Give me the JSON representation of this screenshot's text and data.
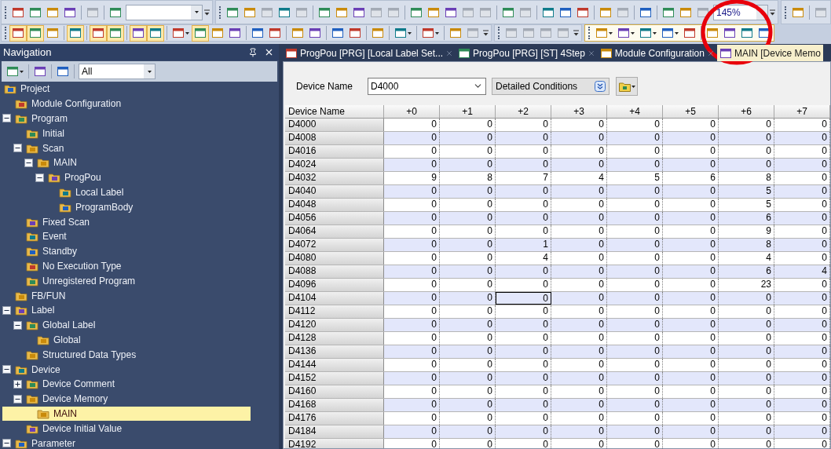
{
  "toolbars": [
    {
      "bands": [
        {
          "highlighted": false,
          "items": [
            {
              "kind": "grip"
            },
            {
              "kind": "button",
              "disabled": false,
              "on": false
            },
            {
              "kind": "button",
              "disabled": false,
              "on": false
            },
            {
              "kind": "button",
              "disabled": false,
              "on": false
            },
            {
              "kind": "button",
              "disabled": false,
              "on": false
            },
            {
              "kind": "separator"
            },
            {
              "kind": "button",
              "disabled": true,
              "on": false
            },
            {
              "kind": "separator"
            },
            {
              "kind": "button",
              "disabled": false,
              "on": false
            },
            {
              "kind": "combo"
            },
            {
              "kind": "overflow"
            }
          ]
        },
        {
          "highlighted": false,
          "items": [
            {
              "kind": "grip"
            },
            {
              "kind": "button",
              "disabled": false,
              "on": false
            },
            {
              "kind": "button",
              "disabled": false,
              "on": false
            },
            {
              "kind": "button",
              "disabled": true,
              "on": false
            },
            {
              "kind": "button",
              "disabled": false,
              "on": false
            },
            {
              "kind": "button",
              "disabled": true,
              "on": false
            },
            {
              "kind": "separator"
            },
            {
              "kind": "button",
              "disabled": false,
              "on": false
            },
            {
              "kind": "button",
              "disabled": false,
              "on": false
            },
            {
              "kind": "button",
              "disabled": false,
              "on": false
            },
            {
              "kind": "button",
              "disabled": true,
              "on": false
            },
            {
              "kind": "button",
              "disabled": true,
              "on": false
            },
            {
              "kind": "separator"
            },
            {
              "kind": "button",
              "disabled": false,
              "on": false
            },
            {
              "kind": "button",
              "disabled": false,
              "on": false
            },
            {
              "kind": "button",
              "disabled": false,
              "on": false
            },
            {
              "kind": "button",
              "disabled": true,
              "on": false
            },
            {
              "kind": "button",
              "disabled": true,
              "on": false
            },
            {
              "kind": "separator"
            },
            {
              "kind": "button",
              "disabled": false,
              "on": false
            },
            {
              "kind": "button",
              "disabled": true,
              "on": false
            },
            {
              "kind": "separator"
            },
            {
              "kind": "button",
              "disabled": false,
              "on": false
            },
            {
              "kind": "button",
              "disabled": false,
              "on": false
            },
            {
              "kind": "button",
              "disabled": false,
              "on": false
            },
            {
              "kind": "separator"
            },
            {
              "kind": "button",
              "disabled": false,
              "on": false
            },
            {
              "kind": "button",
              "disabled": true,
              "on": false
            },
            {
              "kind": "separator"
            },
            {
              "kind": "button",
              "disabled": false,
              "on": false
            },
            {
              "kind": "separator"
            },
            {
              "kind": "button",
              "disabled": false,
              "on": false
            },
            {
              "kind": "button",
              "disabled": false,
              "on": false
            },
            {
              "kind": "button",
              "disabled": true,
              "on": false
            },
            {
              "kind": "zoom_combo",
              "value": "145%"
            },
            {
              "kind": "overflow"
            }
          ]
        },
        {
          "highlighted": false,
          "items": [
            {
              "kind": "grip"
            },
            {
              "kind": "button",
              "disabled": false,
              "on": false
            },
            {
              "kind": "separator"
            },
            {
              "kind": "button",
              "disabled": true,
              "on": false
            }
          ]
        }
      ]
    },
    {
      "bands": [
        {
          "highlighted": false,
          "items": [
            {
              "kind": "grip"
            },
            {
              "kind": "button",
              "disabled": false,
              "on": true
            },
            {
              "kind": "button",
              "disabled": false,
              "on": true
            },
            {
              "kind": "button",
              "disabled": false,
              "on": false
            },
            {
              "kind": "separator"
            },
            {
              "kind": "button",
              "disabled": false,
              "on": true
            },
            {
              "kind": "separator"
            },
            {
              "kind": "button",
              "disabled": false,
              "on": true
            },
            {
              "kind": "button",
              "disabled": false,
              "on": true
            },
            {
              "kind": "separator"
            },
            {
              "kind": "button",
              "disabled": false,
              "on": true
            },
            {
              "kind": "button",
              "disabled": false,
              "on": true
            },
            {
              "kind": "separator"
            },
            {
              "kind": "menu_button",
              "disabled": false,
              "on": false
            },
            {
              "kind": "button",
              "disabled": false,
              "on": true
            },
            {
              "kind": "button",
              "disabled": false,
              "on": false
            },
            {
              "kind": "button",
              "disabled": false,
              "on": false
            },
            {
              "kind": "separator"
            },
            {
              "kind": "button",
              "disabled": false,
              "on": false
            },
            {
              "kind": "button",
              "disabled": false,
              "on": false
            },
            {
              "kind": "separator"
            },
            {
              "kind": "button",
              "disabled": false,
              "on": false
            },
            {
              "kind": "button",
              "disabled": false,
              "on": false
            },
            {
              "kind": "separator"
            },
            {
              "kind": "button",
              "disabled": false,
              "on": false
            },
            {
              "kind": "button",
              "disabled": false,
              "on": false
            },
            {
              "kind": "separator"
            },
            {
              "kind": "button",
              "disabled": false,
              "on": false
            },
            {
              "kind": "separator"
            },
            {
              "kind": "menu_button",
              "disabled": false,
              "on": false
            },
            {
              "kind": "separator"
            },
            {
              "kind": "menu_button",
              "disabled": false,
              "on": false
            },
            {
              "kind": "separator"
            },
            {
              "kind": "button",
              "disabled": false,
              "on": false
            },
            {
              "kind": "button",
              "disabled": true,
              "on": false
            },
            {
              "kind": "overflow"
            }
          ]
        },
        {
          "highlighted": false,
          "items": [
            {
              "kind": "grip"
            },
            {
              "kind": "button",
              "disabled": true,
              "on": false
            },
            {
              "kind": "button",
              "disabled": true,
              "on": false
            },
            {
              "kind": "button",
              "disabled": true,
              "on": false
            },
            {
              "kind": "button",
              "disabled": true,
              "on": false
            },
            {
              "kind": "overflow"
            }
          ]
        },
        {
          "highlighted": true,
          "items": [
            {
              "kind": "grip"
            },
            {
              "kind": "menu_button",
              "disabled": false,
              "on": false
            },
            {
              "kind": "menu_button",
              "disabled": false,
              "on": false
            },
            {
              "kind": "menu_button",
              "disabled": false,
              "on": false
            },
            {
              "kind": "menu_button",
              "disabled": false,
              "on": false
            },
            {
              "kind": "button",
              "disabled": false,
              "on": false
            },
            {
              "kind": "separator"
            },
            {
              "kind": "button",
              "disabled": false,
              "on": false
            },
            {
              "kind": "button",
              "disabled": false,
              "on": false
            },
            {
              "kind": "button",
              "disabled": false,
              "on": false
            },
            {
              "kind": "button",
              "disabled": false,
              "on": false
            }
          ]
        }
      ]
    }
  ],
  "navigation": {
    "title": "Navigation",
    "toolbar": [
      {
        "kind": "menu_button",
        "disabled": false,
        "on": false
      },
      {
        "kind": "separator"
      },
      {
        "kind": "button",
        "disabled": false,
        "on": false
      },
      {
        "kind": "separator"
      },
      {
        "kind": "button",
        "disabled": false,
        "on": false
      },
      {
        "kind": "separator"
      },
      {
        "kind": "combo",
        "value": "All"
      }
    ],
    "tree": [
      {
        "label": "Project",
        "selected": false,
        "children": [
          {
            "label": "Module Configuration",
            "selected": false
          },
          {
            "label": "Program",
            "selected": false,
            "expanded": true,
            "children": [
              {
                "label": "Initial",
                "selected": false
              },
              {
                "label": "Scan",
                "selected": false,
                "expanded": true,
                "children": [
                  {
                    "label": "MAIN",
                    "selected": false,
                    "expanded": true,
                    "children": [
                      {
                        "label": "ProgPou",
                        "selected": false,
                        "expanded": true,
                        "children": [
                          {
                            "label": "Local Label",
                            "selected": false
                          },
                          {
                            "label": "ProgramBody",
                            "selected": false
                          }
                        ]
                      }
                    ]
                  }
                ]
              },
              {
                "label": "Fixed Scan",
                "selected": false
              },
              {
                "label": "Event",
                "selected": false
              },
              {
                "label": "Standby",
                "selected": false
              },
              {
                "label": "No Execution Type",
                "selected": false
              },
              {
                "label": "Unregistered Program",
                "selected": false
              }
            ]
          },
          {
            "label": "FB/FUN",
            "selected": false
          },
          {
            "label": "Label",
            "selected": false,
            "expanded": true,
            "children": [
              {
                "label": "Global Label",
                "selected": false,
                "expanded": true,
                "children": [
                  {
                    "label": "Global",
                    "selected": false
                  }
                ]
              },
              {
                "label": "Structured Data Types",
                "selected": false
              }
            ]
          },
          {
            "label": "Device",
            "selected": false,
            "expanded": true,
            "children": [
              {
                "label": "Device Comment",
                "selected": false,
                "expanded": false
              },
              {
                "label": "Device Memory",
                "selected": false,
                "expanded": true,
                "children": [
                  {
                    "label": "MAIN",
                    "selected": true
                  }
                ]
              },
              {
                "label": "Device Initial Value",
                "selected": false
              }
            ]
          },
          {
            "label": "Parameter",
            "selected": false,
            "expanded": true
          }
        ]
      }
    ]
  },
  "tabs": [
    {
      "label": "ProgPou [PRG] [Local Label Set...",
      "selected": false
    },
    {
      "label": "ProgPou [PRG] [ST] 4Step",
      "selected": false
    },
    {
      "label": "Module Configuration",
      "selected": false
    },
    {
      "label": "MAIN [Device Memo",
      "selected": true
    }
  ],
  "device_name": {
    "label": "Device Name",
    "value": "D4000"
  },
  "detailed_conditions": "Detailed Conditions",
  "table": {
    "columns": [
      "Device Name",
      "+0",
      "+1",
      "+2",
      "+3",
      "+4",
      "+5",
      "+6",
      "+7"
    ],
    "rows": [
      {
        "name": "D4000",
        "cells": [
          {
            "text": "0",
            "selected": false
          },
          {
            "text": "0",
            "selected": false
          },
          {
            "text": "0",
            "selected": false
          },
          {
            "text": "0",
            "selected": false
          },
          {
            "text": "0",
            "selected": false
          },
          {
            "text": "0",
            "selected": false
          },
          {
            "text": "0",
            "selected": false
          },
          {
            "text": "0",
            "selected": false
          }
        ]
      },
      {
        "name": "D4008",
        "cells": [
          {
            "text": "0",
            "selected": false
          },
          {
            "text": "0",
            "selected": false
          },
          {
            "text": "0",
            "selected": false
          },
          {
            "text": "0",
            "selected": false
          },
          {
            "text": "0",
            "selected": false
          },
          {
            "text": "0",
            "selected": false
          },
          {
            "text": "0",
            "selected": false
          },
          {
            "text": "0",
            "selected": false
          }
        ]
      },
      {
        "name": "D4016",
        "cells": [
          {
            "text": "0",
            "selected": false
          },
          {
            "text": "0",
            "selected": false
          },
          {
            "text": "0",
            "selected": false
          },
          {
            "text": "0",
            "selected": false
          },
          {
            "text": "0",
            "selected": false
          },
          {
            "text": "0",
            "selected": false
          },
          {
            "text": "0",
            "selected": false
          },
          {
            "text": "0",
            "selected": false
          }
        ]
      },
      {
        "name": "D4024",
        "cells": [
          {
            "text": "0",
            "selected": false
          },
          {
            "text": "0",
            "selected": false
          },
          {
            "text": "0",
            "selected": false
          },
          {
            "text": "0",
            "selected": false
          },
          {
            "text": "0",
            "selected": false
          },
          {
            "text": "0",
            "selected": false
          },
          {
            "text": "0",
            "selected": false
          },
          {
            "text": "0",
            "selected": false
          }
        ]
      },
      {
        "name": "D4032",
        "cells": [
          {
            "text": "9",
            "selected": false
          },
          {
            "text": "8",
            "selected": false
          },
          {
            "text": "7",
            "selected": false
          },
          {
            "text": "4",
            "selected": false
          },
          {
            "text": "5",
            "selected": false
          },
          {
            "text": "6",
            "selected": false
          },
          {
            "text": "8",
            "selected": false
          },
          {
            "text": "0",
            "selected": false
          }
        ]
      },
      {
        "name": "D4040",
        "cells": [
          {
            "text": "0",
            "selected": false
          },
          {
            "text": "0",
            "selected": false
          },
          {
            "text": "0",
            "selected": false
          },
          {
            "text": "0",
            "selected": false
          },
          {
            "text": "0",
            "selected": false
          },
          {
            "text": "0",
            "selected": false
          },
          {
            "text": "5",
            "selected": false
          },
          {
            "text": "0",
            "selected": false
          }
        ]
      },
      {
        "name": "D4048",
        "cells": [
          {
            "text": "0",
            "selected": false
          },
          {
            "text": "0",
            "selected": false
          },
          {
            "text": "0",
            "selected": false
          },
          {
            "text": "0",
            "selected": false
          },
          {
            "text": "0",
            "selected": false
          },
          {
            "text": "0",
            "selected": false
          },
          {
            "text": "5",
            "selected": false
          },
          {
            "text": "0",
            "selected": false
          }
        ]
      },
      {
        "name": "D4056",
        "cells": [
          {
            "text": "0",
            "selected": false
          },
          {
            "text": "0",
            "selected": false
          },
          {
            "text": "0",
            "selected": false
          },
          {
            "text": "0",
            "selected": false
          },
          {
            "text": "0",
            "selected": false
          },
          {
            "text": "0",
            "selected": false
          },
          {
            "text": "6",
            "selected": false
          },
          {
            "text": "0",
            "selected": false
          }
        ]
      },
      {
        "name": "D4064",
        "cells": [
          {
            "text": "0",
            "selected": false
          },
          {
            "text": "0",
            "selected": false
          },
          {
            "text": "0",
            "selected": false
          },
          {
            "text": "0",
            "selected": false
          },
          {
            "text": "0",
            "selected": false
          },
          {
            "text": "0",
            "selected": false
          },
          {
            "text": "9",
            "selected": false
          },
          {
            "text": "0",
            "selected": false
          }
        ]
      },
      {
        "name": "D4072",
        "cells": [
          {
            "text": "0",
            "selected": false
          },
          {
            "text": "0",
            "selected": false
          },
          {
            "text": "1",
            "selected": false
          },
          {
            "text": "0",
            "selected": false
          },
          {
            "text": "0",
            "selected": false
          },
          {
            "text": "0",
            "selected": false
          },
          {
            "text": "8",
            "selected": false
          },
          {
            "text": "0",
            "selected": false
          }
        ]
      },
      {
        "name": "D4080",
        "cells": [
          {
            "text": "0",
            "selected": false
          },
          {
            "text": "0",
            "selected": false
          },
          {
            "text": "4",
            "selected": false
          },
          {
            "text": "0",
            "selected": false
          },
          {
            "text": "0",
            "selected": false
          },
          {
            "text": "0",
            "selected": false
          },
          {
            "text": "4",
            "selected": false
          },
          {
            "text": "0",
            "selected": false
          }
        ]
      },
      {
        "name": "D4088",
        "cells": [
          {
            "text": "0",
            "selected": false
          },
          {
            "text": "0",
            "selected": false
          },
          {
            "text": "0",
            "selected": false
          },
          {
            "text": "0",
            "selected": false
          },
          {
            "text": "0",
            "selected": false
          },
          {
            "text": "0",
            "selected": false
          },
          {
            "text": "6",
            "selected": false
          },
          {
            "text": "4",
            "selected": false
          }
        ]
      },
      {
        "name": "D4096",
        "cells": [
          {
            "text": "0",
            "selected": false
          },
          {
            "text": "0",
            "selected": false
          },
          {
            "text": "0",
            "selected": false
          },
          {
            "text": "0",
            "selected": false
          },
          {
            "text": "0",
            "selected": false
          },
          {
            "text": "0",
            "selected": false
          },
          {
            "text": "23",
            "selected": false
          },
          {
            "text": "0",
            "selected": false
          }
        ]
      },
      {
        "name": "D4104",
        "cells": [
          {
            "text": "0",
            "selected": false
          },
          {
            "text": "0",
            "selected": false
          },
          {
            "text": "0",
            "selected": true
          },
          {
            "text": "0",
            "selected": false
          },
          {
            "text": "0",
            "selected": false
          },
          {
            "text": "0",
            "selected": false
          },
          {
            "text": "0",
            "selected": false
          },
          {
            "text": "0",
            "selected": false
          }
        ]
      },
      {
        "name": "D4112",
        "cells": [
          {
            "text": "0",
            "selected": false
          },
          {
            "text": "0",
            "selected": false
          },
          {
            "text": "0",
            "selected": false
          },
          {
            "text": "0",
            "selected": false
          },
          {
            "text": "0",
            "selected": false
          },
          {
            "text": "0",
            "selected": false
          },
          {
            "text": "0",
            "selected": false
          },
          {
            "text": "0",
            "selected": false
          }
        ]
      },
      {
        "name": "D4120",
        "cells": [
          {
            "text": "0",
            "selected": false
          },
          {
            "text": "0",
            "selected": false
          },
          {
            "text": "0",
            "selected": false
          },
          {
            "text": "0",
            "selected": false
          },
          {
            "text": "0",
            "selected": false
          },
          {
            "text": "0",
            "selected": false
          },
          {
            "text": "0",
            "selected": false
          },
          {
            "text": "0",
            "selected": false
          }
        ]
      },
      {
        "name": "D4128",
        "cells": [
          {
            "text": "0",
            "selected": false
          },
          {
            "text": "0",
            "selected": false
          },
          {
            "text": "0",
            "selected": false
          },
          {
            "text": "0",
            "selected": false
          },
          {
            "text": "0",
            "selected": false
          },
          {
            "text": "0",
            "selected": false
          },
          {
            "text": "0",
            "selected": false
          },
          {
            "text": "0",
            "selected": false
          }
        ]
      },
      {
        "name": "D4136",
        "cells": [
          {
            "text": "0",
            "selected": false
          },
          {
            "text": "0",
            "selected": false
          },
          {
            "text": "0",
            "selected": false
          },
          {
            "text": "0",
            "selected": false
          },
          {
            "text": "0",
            "selected": false
          },
          {
            "text": "0",
            "selected": false
          },
          {
            "text": "0",
            "selected": false
          },
          {
            "text": "0",
            "selected": false
          }
        ]
      },
      {
        "name": "D4144",
        "cells": [
          {
            "text": "0",
            "selected": false
          },
          {
            "text": "0",
            "selected": false
          },
          {
            "text": "0",
            "selected": false
          },
          {
            "text": "0",
            "selected": false
          },
          {
            "text": "0",
            "selected": false
          },
          {
            "text": "0",
            "selected": false
          },
          {
            "text": "0",
            "selected": false
          },
          {
            "text": "0",
            "selected": false
          }
        ]
      },
      {
        "name": "D4152",
        "cells": [
          {
            "text": "0",
            "selected": false
          },
          {
            "text": "0",
            "selected": false
          },
          {
            "text": "0",
            "selected": false
          },
          {
            "text": "0",
            "selected": false
          },
          {
            "text": "0",
            "selected": false
          },
          {
            "text": "0",
            "selected": false
          },
          {
            "text": "0",
            "selected": false
          },
          {
            "text": "0",
            "selected": false
          }
        ]
      },
      {
        "name": "D4160",
        "cells": [
          {
            "text": "0",
            "selected": false
          },
          {
            "text": "0",
            "selected": false
          },
          {
            "text": "0",
            "selected": false
          },
          {
            "text": "0",
            "selected": false
          },
          {
            "text": "0",
            "selected": false
          },
          {
            "text": "0",
            "selected": false
          },
          {
            "text": "0",
            "selected": false
          },
          {
            "text": "0",
            "selected": false
          }
        ]
      },
      {
        "name": "D4168",
        "cells": [
          {
            "text": "0",
            "selected": false
          },
          {
            "text": "0",
            "selected": false
          },
          {
            "text": "0",
            "selected": false
          },
          {
            "text": "0",
            "selected": false
          },
          {
            "text": "0",
            "selected": false
          },
          {
            "text": "0",
            "selected": false
          },
          {
            "text": "0",
            "selected": false
          },
          {
            "text": "0",
            "selected": false
          }
        ]
      },
      {
        "name": "D4176",
        "cells": [
          {
            "text": "0",
            "selected": false
          },
          {
            "text": "0",
            "selected": false
          },
          {
            "text": "0",
            "selected": false
          },
          {
            "text": "0",
            "selected": false
          },
          {
            "text": "0",
            "selected": false
          },
          {
            "text": "0",
            "selected": false
          },
          {
            "text": "0",
            "selected": false
          },
          {
            "text": "0",
            "selected": false
          }
        ]
      },
      {
        "name": "D4184",
        "cells": [
          {
            "text": "0",
            "selected": false
          },
          {
            "text": "0",
            "selected": false
          },
          {
            "text": "0",
            "selected": false
          },
          {
            "text": "0",
            "selected": false
          },
          {
            "text": "0",
            "selected": false
          },
          {
            "text": "0",
            "selected": false
          },
          {
            "text": "0",
            "selected": false
          },
          {
            "text": "0",
            "selected": false
          }
        ]
      },
      {
        "name": "D4192",
        "cells": [
          {
            "text": "0",
            "selected": false
          },
          {
            "text": "0",
            "selected": false
          },
          {
            "text": "0",
            "selected": false
          },
          {
            "text": "0",
            "selected": false
          },
          {
            "text": "0",
            "selected": false
          },
          {
            "text": "0",
            "selected": false
          },
          {
            "text": "0",
            "selected": false
          },
          {
            "text": "0",
            "selected": false
          }
        ]
      }
    ]
  }
}
